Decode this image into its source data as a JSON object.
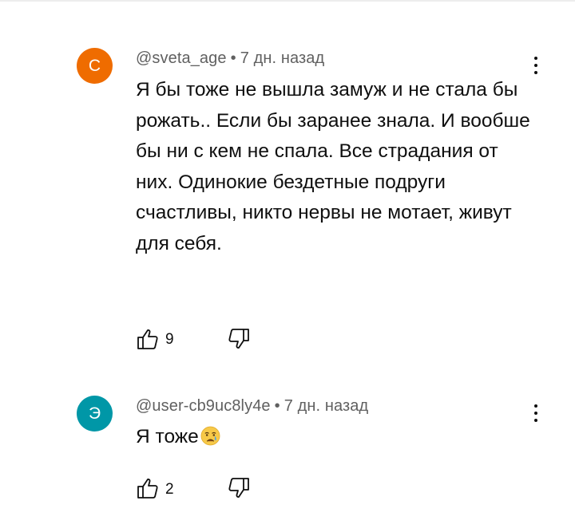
{
  "comments": [
    {
      "avatar_letter": "С",
      "avatar_color": "#ef6c00",
      "author": "@sveta_age",
      "separator": "•",
      "time": "7 дн. назад",
      "text": "Я бы тоже не вышла замуж и не стала бы рожать.. Если бы заранее знала. И вообше бы ни с кем не спала. Все страдания от них. Одинокие бездетные подруги счастливы, никто нервы не мотает, живут для себя.",
      "likes": "9"
    },
    {
      "avatar_letter": "Э",
      "avatar_color": "#0097a7",
      "author": "@user-cb9uc8ly4e",
      "separator": "•",
      "time": "7 дн. назад",
      "text": "Я тоже",
      "emoji": "crying-face-emoji",
      "likes": "2"
    }
  ],
  "icons": {
    "like": "thumb-up-icon",
    "dislike": "thumb-down-icon",
    "menu": "more-vert-icon"
  }
}
